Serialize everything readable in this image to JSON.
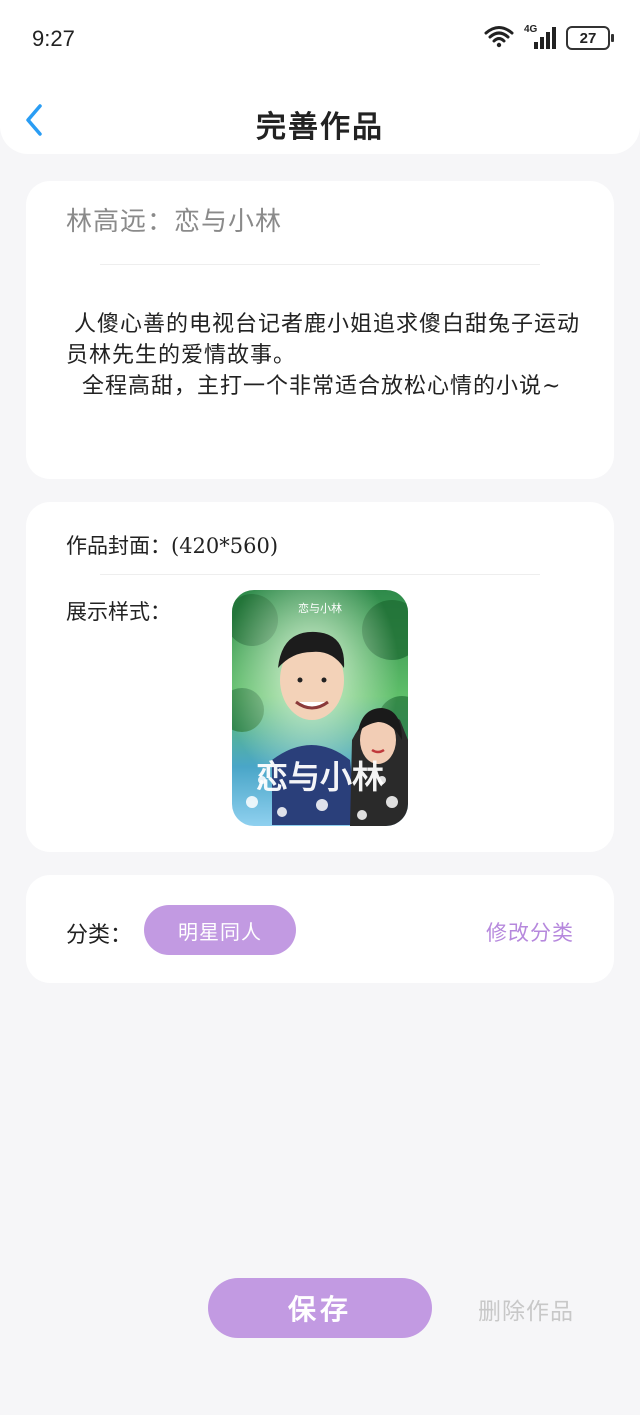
{
  "status_bar": {
    "time": "9:27",
    "network": "4G",
    "battery": "27"
  },
  "header": {
    "title": "完善作品",
    "back_icon": "chevron-left-icon"
  },
  "novel": {
    "title": "林高远：恋与小林",
    "intro_lines": [
      " 人傻心善的电视台记者鹿小姐追求傻白甜兔子运动员林先生的爱情故事。",
      "  全程高甜，主打一个非常适合放松心情的小说~"
    ]
  },
  "cover": {
    "label": "作品封面：(420*560)",
    "display_label": "展示样式：",
    "cover_top_text": "恋与小林",
    "cover_title": "恋与小林"
  },
  "category": {
    "label": "分类：",
    "tag": "明星同人",
    "edit_label": "修改分类"
  },
  "actions": {
    "save_label": "保存",
    "delete_label": "删除作品"
  },
  "colors": {
    "accent": "#c29ae2",
    "accent_text": "#b688dd",
    "back_arrow": "#2a9df4",
    "background": "#f6f6f8"
  }
}
